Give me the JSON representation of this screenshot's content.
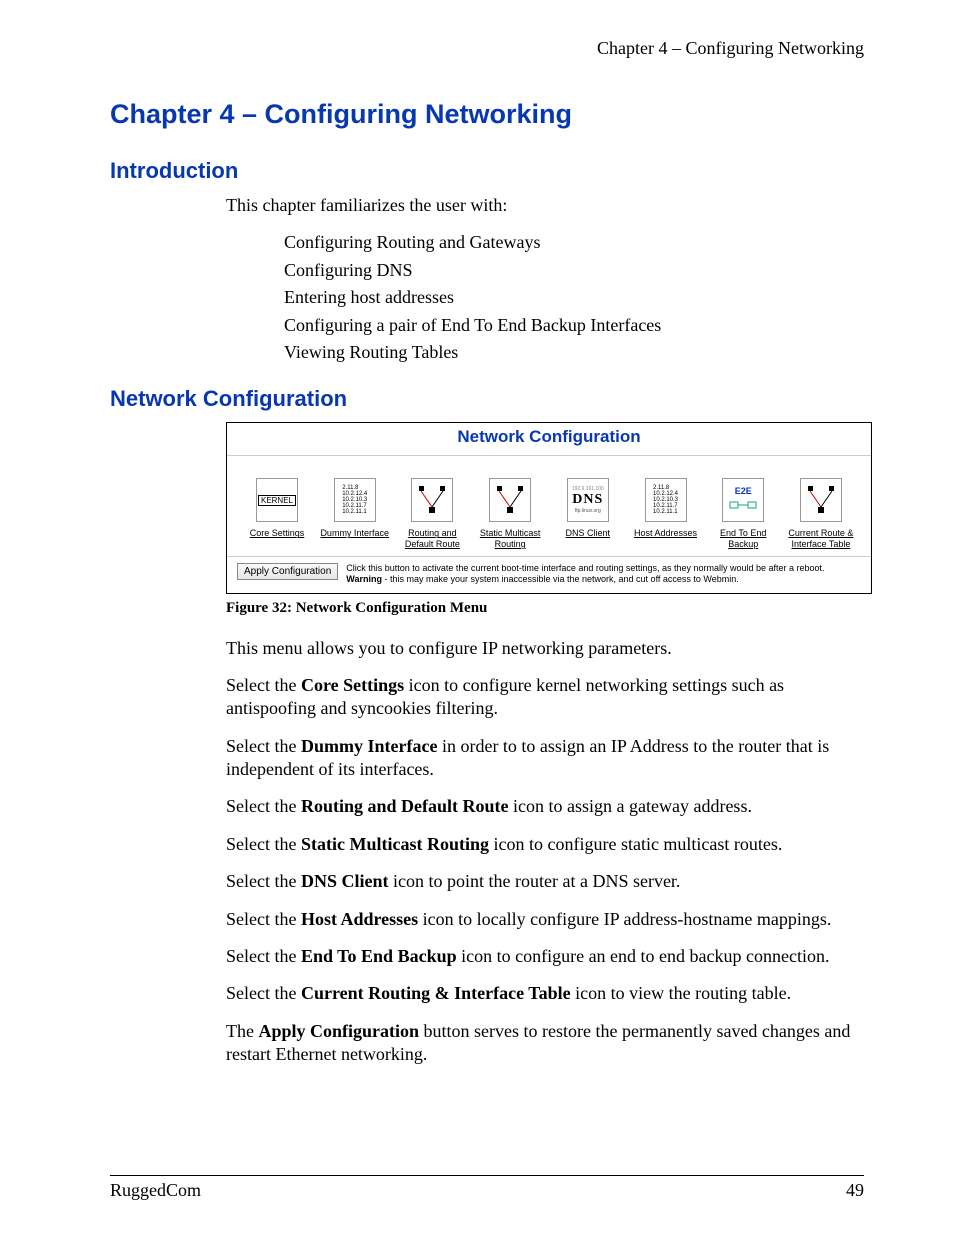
{
  "running_head": "Chapter 4 – Configuring Networking",
  "h1": "Chapter 4 – Configuring Networking",
  "intro_h2": "Introduction",
  "intro_lead": "This chapter familiarizes the user with:",
  "intro_items": [
    "Configuring Routing and Gateways",
    "Configuring DNS",
    "Entering host addresses",
    "Configuring a pair of End To End Backup Interfaces",
    "Viewing Routing Tables"
  ],
  "netconf_h2": "Network Configuration",
  "figure": {
    "panel_title": "Network Configuration",
    "icons": {
      "core": "Core Settings",
      "dummy": "Dummy Interface",
      "routing": "Routing and Default Route",
      "smr": "Static Multicast Routing",
      "dns": "DNS Client",
      "host": "Host Addresses",
      "e2e": "End To End Backup",
      "crit": "Current Route & Interface Table"
    },
    "kernel_label": "KERNEL",
    "dns_label": "DNS",
    "dns_sub": "ftp.linux.org",
    "dns_top": "192.9.161.100",
    "e2e_label": "E2E",
    "ip_lists": {
      "dummy": [
        "2.11.8",
        "10.2.12.4",
        "10.2.10.3",
        "10.2.11.7",
        "10.2.11.1"
      ],
      "host": [
        "2.11.8",
        "10.2.12.4",
        "10.2.10.3",
        "10.2.11.7",
        "10.2.11.1"
      ]
    },
    "apply_btn": "Apply Configuration",
    "apply_text_pre": "Click this button to activate the current boot-time interface and routing settings, as they normally would be after a reboot. ",
    "apply_text_warn": "Warning",
    "apply_text_post": " - this may make your system inaccessible via the network, and cut off access to Webmin.",
    "caption": "Figure 32: Network Configuration Menu"
  },
  "paras": [
    {
      "pre": "This menu allows you to configure IP networking parameters.",
      "bold": "",
      "post": ""
    },
    {
      "pre": "Select the ",
      "bold": "Core Settings",
      "post": " icon to configure kernel networking settings such as antispoofing and syncookies filtering."
    },
    {
      "pre": "Select the ",
      "bold": "Dummy Interface",
      "post": " in order to to assign an IP Address to the router that is independent of its interfaces."
    },
    {
      "pre": "Select the ",
      "bold": "Routing and Default Route",
      "post": " icon to assign a gateway address."
    },
    {
      "pre": "Select the ",
      "bold": "Static Multicast Routing",
      "post": " icon to configure static multicast routes."
    },
    {
      "pre": "Select the ",
      "bold": "DNS Client",
      "post": " icon to point the router at a DNS server."
    },
    {
      "pre": "Select the ",
      "bold": "Host Addresses",
      "post": " icon to locally configure IP address-hostname mappings."
    },
    {
      "pre": "Select the ",
      "bold": "End To End Backup",
      "post": " icon to configure an end to end backup connection."
    },
    {
      "pre": "Select the ",
      "bold": "Current Routing & Interface Table",
      "post": " icon to view the routing table."
    },
    {
      "pre": "The ",
      "bold": "Apply Configuration",
      "post": " button serves to restore the permanently saved changes and restart Ethernet networking."
    }
  ],
  "footer_left": "RuggedCom",
  "footer_right": "49"
}
